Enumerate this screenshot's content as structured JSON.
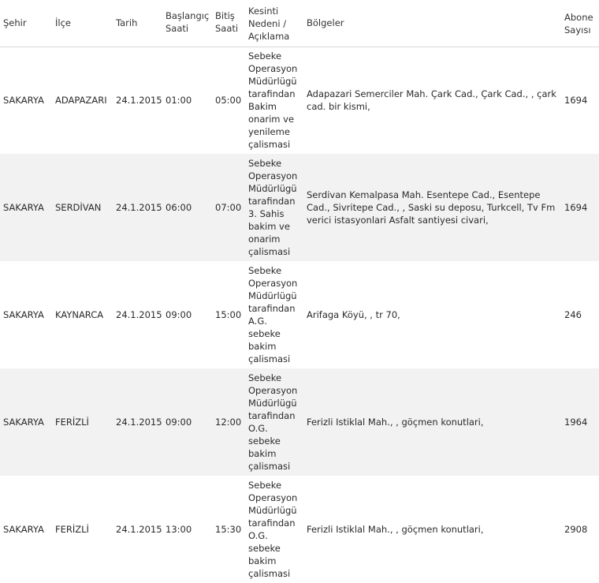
{
  "headers": {
    "sehir": "Şehir",
    "ilce": "İlçe",
    "tarih": "Tarih",
    "baslangic": "Başlangıç Saati",
    "bitis": "Bitiş Saati",
    "neden": "Kesinti Nedeni / Açıklama",
    "bolgeler": "Bölgeler",
    "abone": "Abone Sayısı"
  },
  "rows": [
    {
      "sehir": "SAKARYA",
      "ilce": "ADAPAZARI",
      "tarih": "24.1.2015",
      "baslangic": "01:00",
      "bitis": "05:00",
      "neden": "Sebeke Operasyon Müdürlügü tarafindan Bakim onarim ve yenileme çalismasi",
      "bolgeler": "Adapazari Semerciler Mah. Çark Cad., Çark Cad., , çark cad. bir kismi,",
      "abone": "1694"
    },
    {
      "sehir": "SAKARYA",
      "ilce": "SERDİVAN",
      "tarih": "24.1.2015",
      "baslangic": "06:00",
      "bitis": "07:00",
      "neden": "Sebeke Operasyon Müdürlügü tarafindan 3. Sahis bakim ve onarim çalismasi",
      "bolgeler": "Serdivan Kemalpasa Mah. Esentepe Cad., Esentepe Cad., Sivritepe Cad., , Saski su deposu, Turkcell, Tv Fm verici istasyonlari Asfalt santiyesi civari,",
      "abone": "1694"
    },
    {
      "sehir": "SAKARYA",
      "ilce": "KAYNARCA",
      "tarih": "24.1.2015",
      "baslangic": "09:00",
      "bitis": "15:00",
      "neden": "Sebeke Operasyon Müdürlügü tarafindan A.G. sebeke bakim çalismasi",
      "bolgeler": "Arifaga Köyü, , tr 70,",
      "abone": "246"
    },
    {
      "sehir": "SAKARYA",
      "ilce": "FERİZLİ",
      "tarih": "24.1.2015",
      "baslangic": "09:00",
      "bitis": "12:00",
      "neden": "Sebeke Operasyon Müdürlügü tarafindan O.G. sebeke bakim çalismasi",
      "bolgeler": "Ferizli Istiklal Mah., , göçmen konutlari,",
      "abone": "1964"
    },
    {
      "sehir": "SAKARYA",
      "ilce": "FERİZLİ",
      "tarih": "24.1.2015",
      "baslangic": "13:00",
      "bitis": "15:30",
      "neden": "Sebeke Operasyon Müdürlügü tarafindan O.G. sebeke bakim çalismasi",
      "bolgeler": "Ferizli Istiklal Mah., , göçmen konutlari,",
      "abone": "2908"
    }
  ]
}
